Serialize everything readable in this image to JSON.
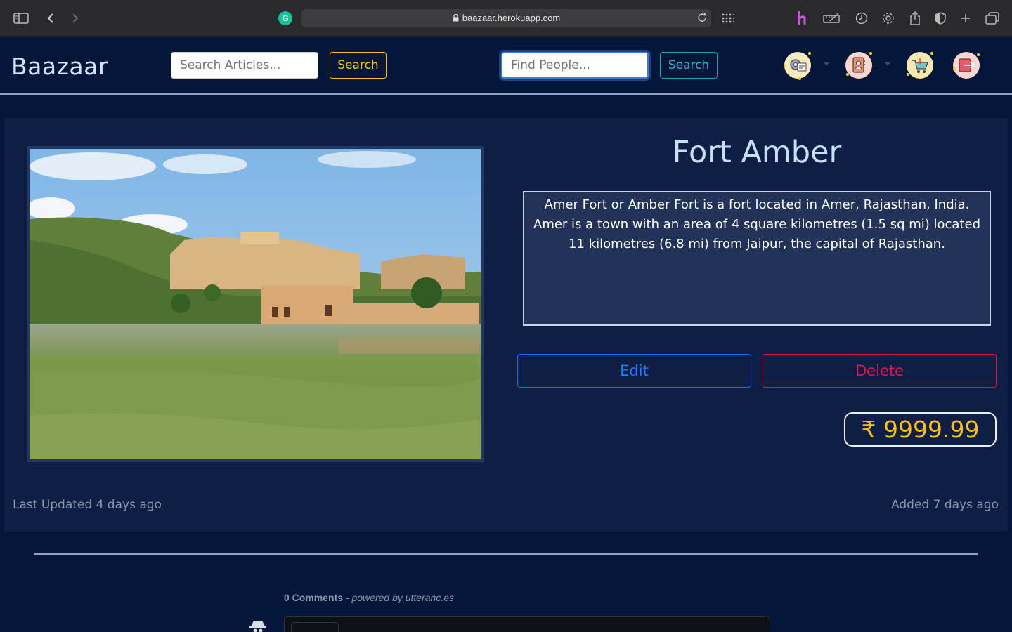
{
  "browser": {
    "url": "baazaar.herokuapp.com"
  },
  "navbar": {
    "brand": "Baazaar",
    "articles_search": {
      "placeholder": "Search Articles...",
      "button": "Search"
    },
    "people_search": {
      "placeholder": "Find People...",
      "button": "Search"
    },
    "icons": [
      "dashboard-icon",
      "contacts-icon",
      "cart-icon",
      "logout-icon"
    ]
  },
  "article": {
    "title": "Fort Amber",
    "description": "Amer Fort or Amber Fort is a fort located in Amer, Rajasthan, India. Amer is a town with an area of 4 square kilometres (1.5 sq mi) located 11 kilometres (6.8 mi) from Jaipur, the capital of Rajasthan.",
    "edit_label": "Edit",
    "delete_label": "Delete",
    "price": "₹ 9999.99",
    "last_updated": "Last Updated 4 days ago",
    "added": "Added 7 days ago"
  },
  "comments": {
    "count": "0 Comments",
    "powered_by": " - powered by utteranc.es"
  },
  "colors": {
    "background": "#04173a",
    "card": "#0f1e45",
    "accent_yellow": "#ffc107",
    "accent_cyan": "#17a2b8",
    "edit_blue": "#0d6efd",
    "delete_red": "#dc143c"
  }
}
